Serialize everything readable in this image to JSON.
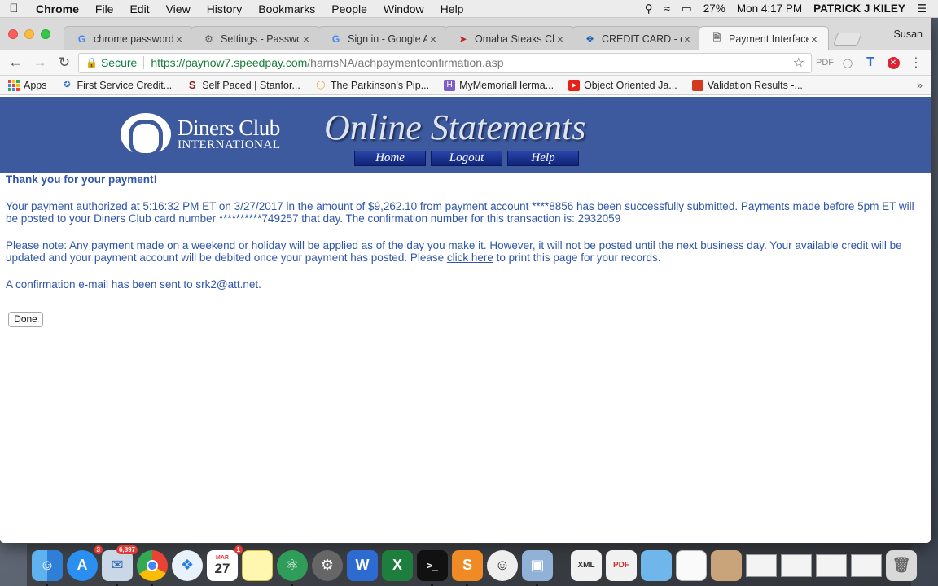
{
  "menubar": {
    "app_name": "Chrome",
    "items": [
      "File",
      "Edit",
      "View",
      "History",
      "Bookmarks",
      "People",
      "Window",
      "Help"
    ],
    "battery": "27%",
    "clock": "Mon 4:17 PM",
    "user": "PATRICK J KILEY"
  },
  "tabs": [
    {
      "title": "chrome passwords",
      "favicon": "google-icon",
      "active": false
    },
    {
      "title": "Settings - Passwords",
      "favicon": "gear-icon",
      "active": false
    },
    {
      "title": "Sign in - Google Accounts",
      "favicon": "google-icon",
      "active": false
    },
    {
      "title": "Omaha Steaks Checkout",
      "favicon": "steak-icon",
      "active": false
    },
    {
      "title": "CREDIT CARD - chase",
      "favicon": "chase-icon",
      "active": false
    },
    {
      "title": "Payment Interface",
      "favicon": "page-icon",
      "active": true
    }
  ],
  "profile_name": "Susan",
  "omnibox": {
    "secure_label": "Secure",
    "host": "https://paynow7.speedpay.com",
    "path": "/harrisNA/achpaymentconfirmation.asp"
  },
  "bookmarks": [
    {
      "label": "Apps"
    },
    {
      "label": "First Service Credit..."
    },
    {
      "label": "Self Paced | Stanfor..."
    },
    {
      "label": "The Parkinson's Pip..."
    },
    {
      "label": "MyMemorialHerma..."
    },
    {
      "label": "Object Oriented Ja..."
    },
    {
      "label": "Validation Results -..."
    }
  ],
  "banner": {
    "logo_line1": "Diners Club",
    "logo_line2": "INTERNATIONAL",
    "headline": "Online Statements",
    "nav": [
      "Home",
      "Logout",
      "Help"
    ]
  },
  "content": {
    "thanks": "Thank you for your payment!",
    "paragraph1": "Your payment authorized at 5:16:32 PM ET on 3/27/2017 in the amount of $9,262.10 from payment account ****8856 has been successfully submitted. Payments made before 5pm ET will be posted to your Diners Club card number **********749257 that day. The confirmation number for this transaction is: 2932059",
    "paragraph2_before": "Please note: Any payment made on a weekend or holiday will be applied as of the day you make it. However, it will not be posted until the next business day. Your available credit will be updated and your payment account will be debited once your payment has posted. Please ",
    "paragraph2_link": "click here",
    "paragraph2_after": " to print this page for your records.",
    "paragraph3": "A confirmation e-mail has been sent to srk2@att.net.",
    "done_label": "Done"
  },
  "dock": {
    "badges": {
      "appstore": "3",
      "mail": "6,897",
      "calendar": "1"
    },
    "calendar_month": "MAR",
    "calendar_day": "27"
  }
}
